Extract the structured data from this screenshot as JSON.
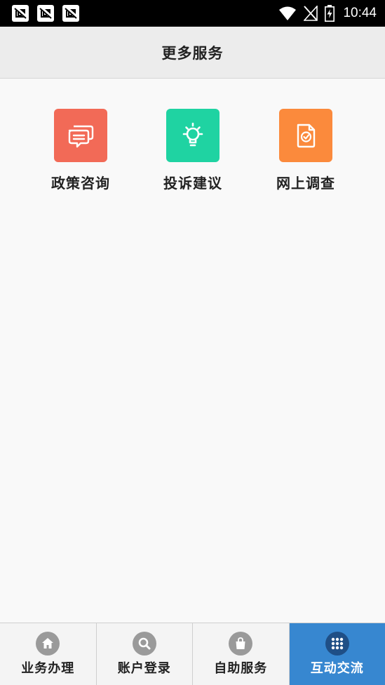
{
  "status_bar": {
    "time": "10:44",
    "notification_icons": [
      "notification-icon",
      "notification-icon",
      "notification-icon"
    ],
    "system_icons": [
      "wifi-icon",
      "no-signal-icon",
      "battery-charging-icon"
    ]
  },
  "header": {
    "title": "更多服务"
  },
  "services": [
    {
      "label": "政策咨询",
      "icon": "chat-bubbles-icon",
      "color": "#f26a57"
    },
    {
      "label": "投诉建议",
      "icon": "lightbulb-icon",
      "color": "#1fd3a2"
    },
    {
      "label": "网上调查",
      "icon": "survey-document-icon",
      "color": "#fb8a3c"
    }
  ],
  "tabs": [
    {
      "label": "业务办理",
      "icon": "home-icon",
      "active": false
    },
    {
      "label": "账户登录",
      "icon": "search-icon",
      "active": false
    },
    {
      "label": "自助服务",
      "icon": "shopping-bag-icon",
      "active": false
    },
    {
      "label": "互动交流",
      "icon": "grid-icon",
      "active": true
    }
  ],
  "colors": {
    "status_bar": "#000000",
    "header_bg": "#ececec",
    "content_bg": "#f9f9f9",
    "tab_active": "#3787d0",
    "tab_icon_inactive": "#9a9a9a",
    "tab_icon_active": "#1f4f86"
  }
}
